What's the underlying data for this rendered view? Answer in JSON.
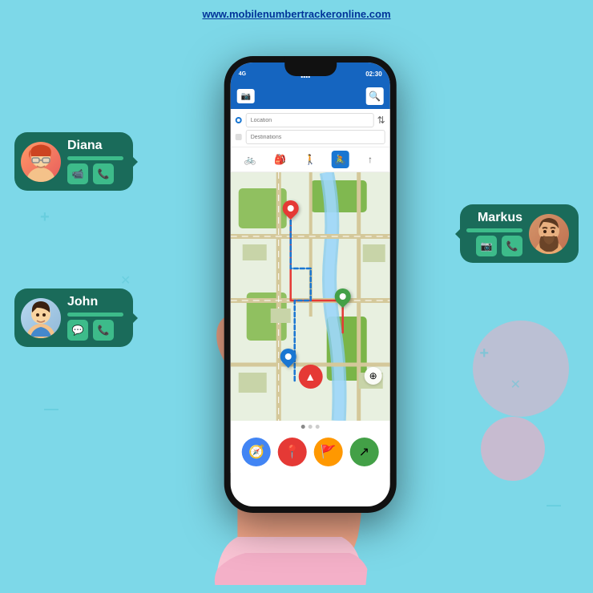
{
  "site": {
    "url": "www.mobilenumbertrackeronline.com"
  },
  "phone": {
    "status_bar": {
      "carrier": "4G",
      "signal": "▲▲▲",
      "time": "02:30",
      "battery": "▌"
    },
    "search": {
      "location_placeholder": "Location",
      "destinations_placeholder": "Destinations"
    },
    "transport_modes": [
      "🚲",
      "🎒",
      "🚶",
      "🚴",
      "↑"
    ],
    "bottom_buttons": [
      {
        "icon": "🧭",
        "color": "#4285f4"
      },
      {
        "icon": "📍",
        "color": "#e53935"
      },
      {
        "icon": "🚩",
        "color": "#ff9800"
      },
      {
        "icon": "↗",
        "color": "#4caf50"
      }
    ]
  },
  "contacts": {
    "diana": {
      "name": "Diana",
      "avatar_emoji": "👩‍🦰",
      "actions": [
        "📹",
        "📞"
      ]
    },
    "john": {
      "name": "John",
      "avatar_emoji": "👦",
      "actions": [
        "💬",
        "📞"
      ]
    },
    "markus": {
      "name": "Markus",
      "avatar_emoji": "🧔",
      "actions": [
        "📷",
        "📞"
      ]
    }
  },
  "colors": {
    "bubble_bg": "#1a6b5a",
    "bubble_bar": "#3dbb8a",
    "phone_bg": "#1a1a2e",
    "header_blue": "#1976d2",
    "sky_blue": "#7dd8e8",
    "pink": "#f9a8c0"
  }
}
